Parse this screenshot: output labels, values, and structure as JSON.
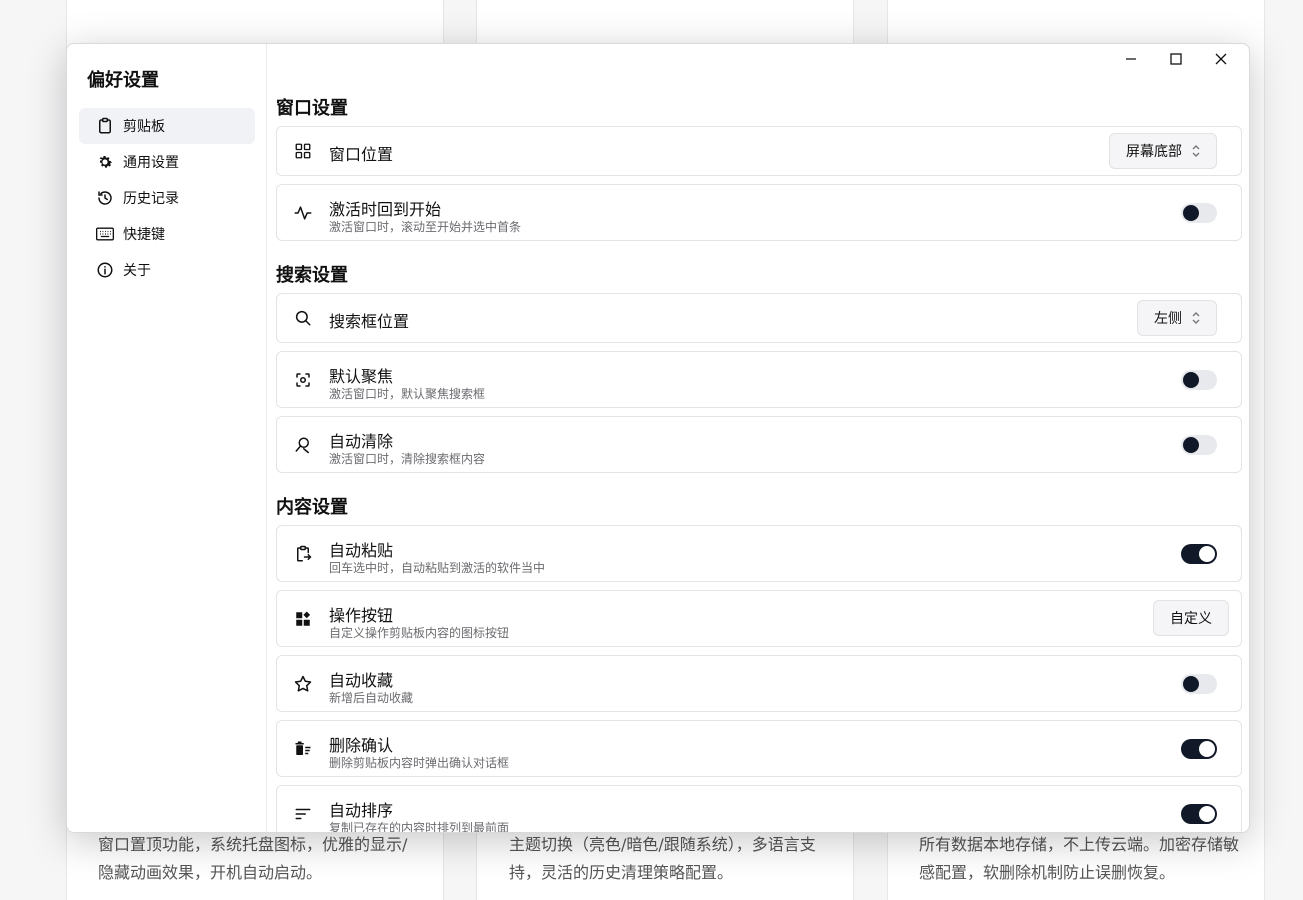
{
  "background": {
    "cards": [
      {
        "text": "窗口置顶功能，系统托盘图标，优雅的显示/隐藏动画效果，开机自动启动。"
      },
      {
        "text": "主题切换（亮色/暗色/跟随系统），多语言支持，灵活的历史清理策略配置。"
      },
      {
        "text": "所有数据本地存储，不上传云端。加密存储敏感配置，软删除机制防止误删恢复。"
      }
    ]
  },
  "sidebar": {
    "title": "偏好设置",
    "items": [
      {
        "label": "剪贴板",
        "icon": "clipboard-icon",
        "active": true
      },
      {
        "label": "通用设置",
        "icon": "gear-icon",
        "active": false
      },
      {
        "label": "历史记录",
        "icon": "history-icon",
        "active": false
      },
      {
        "label": "快捷键",
        "icon": "keyboard-icon",
        "active": false
      },
      {
        "label": "关于",
        "icon": "info-icon",
        "active": false
      }
    ]
  },
  "sections": {
    "window": {
      "title": "窗口设置",
      "position": {
        "title": "窗口位置",
        "value": "屏幕底部"
      },
      "back_to_top": {
        "title": "激活时回到开始",
        "desc": "激活窗口时，滚动至开始并选中首条",
        "on": false
      }
    },
    "search": {
      "title": "搜索设置",
      "position": {
        "title": "搜索框位置",
        "value": "左侧"
      },
      "default_focus": {
        "title": "默认聚焦",
        "desc": "激活窗口时，默认聚焦搜索框",
        "on": false
      },
      "auto_clear": {
        "title": "自动清除",
        "desc": "激活窗口时，清除搜索框内容",
        "on": false
      }
    },
    "content": {
      "title": "内容设置",
      "auto_paste": {
        "title": "自动粘贴",
        "desc": "回车选中时，自动粘贴到激活的软件当中",
        "on": true
      },
      "action_buttons": {
        "title": "操作按钮",
        "desc": "自定义操作剪贴板内容的图标按钮",
        "button": "自定义"
      },
      "auto_favorite": {
        "title": "自动收藏",
        "desc": "新增后自动收藏",
        "on": false
      },
      "delete_confirm": {
        "title": "删除确认",
        "desc": "删除剪贴板内容时弹出确认对话框",
        "on": true
      },
      "auto_sort": {
        "title": "自动排序",
        "desc": "复制已存在的内容时排列到最前面",
        "on": true
      }
    }
  },
  "colors": {
    "toggle_on": "#111827",
    "toggle_off": "#e8e9ed",
    "active_nav": "#f1f2f5"
  }
}
